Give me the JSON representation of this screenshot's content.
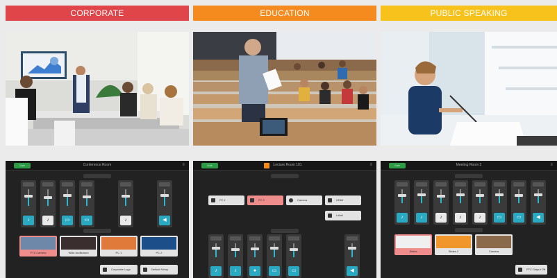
{
  "banners": [
    "CORPORATE",
    "EDUCATION",
    "PUBLIC SPEAKING"
  ],
  "colors": {
    "corporate": "#e0454a",
    "education": "#f58a1f",
    "public_speaking": "#f7c21c",
    "panel": "#222222",
    "accent": "#2aa9c2",
    "live": "#ef8c8c"
  },
  "photos": [
    "Conference room meeting",
    "Lecture hall",
    "Speaker at podium"
  ],
  "panels": [
    {
      "status": "Live",
      "title": "Conference Room",
      "thumbs": [
        "PTZ Camera",
        "Wide Auditorium",
        "PC 1",
        "PC 2"
      ],
      "buttons": [
        "Corporate Logo",
        "Default Setup"
      ]
    },
    {
      "status": "Live",
      "title": "Lecture Room 101",
      "buttons": [
        "PC 1",
        "PC 2",
        "Camera",
        "HDMI",
        "Label"
      ]
    },
    {
      "status": "Live",
      "title": "Meeting Room 2",
      "thumbs": [
        "Slides",
        "Slides 2",
        "Camera"
      ],
      "buttons": [
        "PTZ Output Off"
      ]
    }
  ]
}
